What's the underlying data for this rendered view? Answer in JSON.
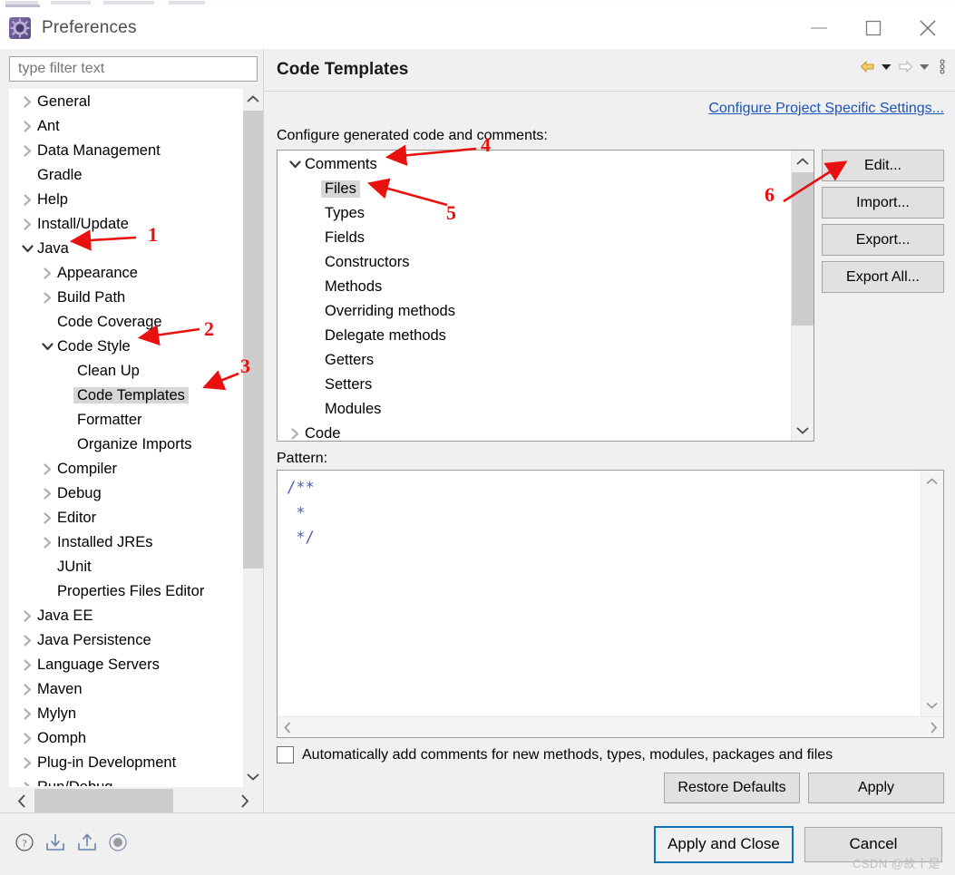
{
  "window": {
    "title": "Preferences",
    "icon": "eclipse-preferences-icon",
    "controls": {
      "minimize": "minimize-icon",
      "maximize": "maximize-icon",
      "close": "close-icon"
    }
  },
  "sidebar": {
    "filter": {
      "placeholder": "type filter text",
      "value": ""
    },
    "items": [
      {
        "label": "General",
        "depth": 1,
        "arrow": "collapsed",
        "selected": false
      },
      {
        "label": "Ant",
        "depth": 1,
        "arrow": "collapsed",
        "selected": false
      },
      {
        "label": "Data Management",
        "depth": 1,
        "arrow": "collapsed",
        "selected": false
      },
      {
        "label": "Gradle",
        "depth": 1,
        "arrow": "none",
        "selected": false
      },
      {
        "label": "Help",
        "depth": 1,
        "arrow": "collapsed",
        "selected": false
      },
      {
        "label": "Install/Update",
        "depth": 1,
        "arrow": "collapsed",
        "selected": false
      },
      {
        "label": "Java",
        "depth": 1,
        "arrow": "expanded",
        "selected": false
      },
      {
        "label": "Appearance",
        "depth": 2,
        "arrow": "collapsed",
        "selected": false
      },
      {
        "label": "Build Path",
        "depth": 2,
        "arrow": "collapsed",
        "selected": false
      },
      {
        "label": "Code Coverage",
        "depth": 2,
        "arrow": "none",
        "selected": false
      },
      {
        "label": "Code Style",
        "depth": 2,
        "arrow": "expanded",
        "selected": false
      },
      {
        "label": "Clean Up",
        "depth": 3,
        "arrow": "none",
        "selected": false
      },
      {
        "label": "Code Templates",
        "depth": 3,
        "arrow": "none",
        "selected": true
      },
      {
        "label": "Formatter",
        "depth": 3,
        "arrow": "none",
        "selected": false
      },
      {
        "label": "Organize Imports",
        "depth": 3,
        "arrow": "none",
        "selected": false
      },
      {
        "label": "Compiler",
        "depth": 2,
        "arrow": "collapsed",
        "selected": false
      },
      {
        "label": "Debug",
        "depth": 2,
        "arrow": "collapsed",
        "selected": false
      },
      {
        "label": "Editor",
        "depth": 2,
        "arrow": "collapsed",
        "selected": false
      },
      {
        "label": "Installed JREs",
        "depth": 2,
        "arrow": "collapsed",
        "selected": false
      },
      {
        "label": "JUnit",
        "depth": 2,
        "arrow": "none",
        "selected": false
      },
      {
        "label": "Properties Files Editor",
        "depth": 2,
        "arrow": "none",
        "selected": false
      },
      {
        "label": "Java EE",
        "depth": 1,
        "arrow": "collapsed",
        "selected": false
      },
      {
        "label": "Java Persistence",
        "depth": 1,
        "arrow": "collapsed",
        "selected": false
      },
      {
        "label": "Language Servers",
        "depth": 1,
        "arrow": "collapsed",
        "selected": false
      },
      {
        "label": "Maven",
        "depth": 1,
        "arrow": "collapsed",
        "selected": false
      },
      {
        "label": "Mylyn",
        "depth": 1,
        "arrow": "collapsed",
        "selected": false
      },
      {
        "label": "Oomph",
        "depth": 1,
        "arrow": "collapsed",
        "selected": false
      },
      {
        "label": "Plug-in Development",
        "depth": 1,
        "arrow": "collapsed",
        "selected": false
      },
      {
        "label": "Run/Debug",
        "depth": 1,
        "arrow": "collapsed",
        "selected": false
      }
    ]
  },
  "page": {
    "title": "Code Templates",
    "nav": {
      "back": "back-arrow-icon",
      "back_menu": "chevron-down-icon",
      "forward": "forward-arrow-icon",
      "forward_menu": "chevron-down-icon",
      "view_menu": "view-menu-icon"
    },
    "project_specific_link": "Configure Project Specific Settings...",
    "configure_label": "Configure generated code and comments:",
    "template_tree": [
      {
        "label": "Comments",
        "depth": 1,
        "arrow": "expanded",
        "selected": false
      },
      {
        "label": "Files",
        "depth": 2,
        "arrow": "none",
        "selected": true
      },
      {
        "label": "Types",
        "depth": 2,
        "arrow": "none",
        "selected": false
      },
      {
        "label": "Fields",
        "depth": 2,
        "arrow": "none",
        "selected": false
      },
      {
        "label": "Constructors",
        "depth": 2,
        "arrow": "none",
        "selected": false
      },
      {
        "label": "Methods",
        "depth": 2,
        "arrow": "none",
        "selected": false
      },
      {
        "label": "Overriding methods",
        "depth": 2,
        "arrow": "none",
        "selected": false
      },
      {
        "label": "Delegate methods",
        "depth": 2,
        "arrow": "none",
        "selected": false
      },
      {
        "label": "Getters",
        "depth": 2,
        "arrow": "none",
        "selected": false
      },
      {
        "label": "Setters",
        "depth": 2,
        "arrow": "none",
        "selected": false
      },
      {
        "label": "Modules",
        "depth": 2,
        "arrow": "none",
        "selected": false
      },
      {
        "label": "Code",
        "depth": 1,
        "arrow": "collapsed",
        "selected": false
      }
    ],
    "buttons": {
      "edit": "Edit...",
      "import": "Import...",
      "export": "Export...",
      "export_all": "Export All..."
    },
    "pattern_label": "Pattern:",
    "pattern_text": "/**\n *\n */",
    "auto_comment_checkbox": {
      "label": "Automatically add comments for new methods, types, modules, packages and files",
      "checked": false
    },
    "restore_defaults": "Restore Defaults",
    "apply": "Apply"
  },
  "footer": {
    "icons": [
      "help-icon",
      "import-icon",
      "export-icon",
      "record-icon"
    ],
    "apply_and_close": "Apply and Close",
    "cancel": "Cancel",
    "watermark": "CSDN @故丨是"
  },
  "annotations": [
    {
      "number": "1",
      "target": "sidebar-item-java"
    },
    {
      "number": "2",
      "target": "sidebar-item-code-style"
    },
    {
      "number": "3",
      "target": "sidebar-item-code-templates"
    },
    {
      "number": "4",
      "target": "template-node-comments"
    },
    {
      "number": "5",
      "target": "template-node-files"
    },
    {
      "number": "6",
      "target": "edit-button"
    }
  ],
  "colors": {
    "accent": "#0a72b8",
    "link": "#1a56b8",
    "annotation": "#e8110f",
    "selection": "#d6d6d6",
    "code": "#4a5fb5"
  }
}
